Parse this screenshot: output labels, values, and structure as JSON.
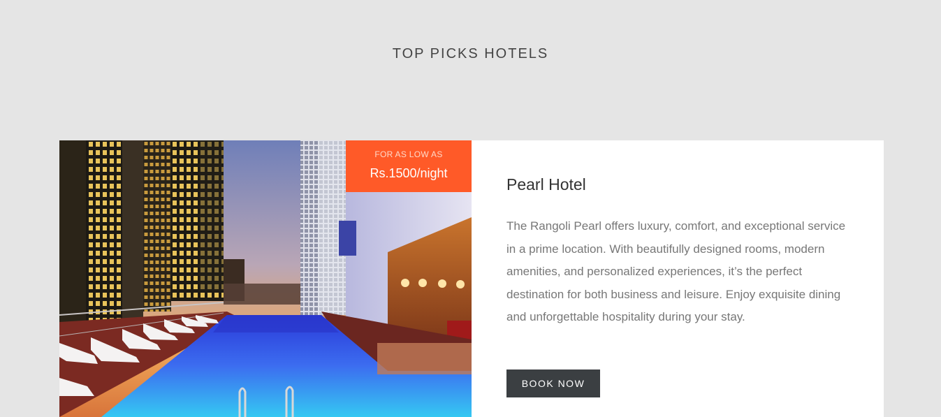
{
  "section": {
    "title": "TOP PICKS HOTELS"
  },
  "hotel": {
    "name": "Pearl Hotel",
    "description": "The Rangoli Pearl offers luxury, comfort, and exceptional service in a prime location. With beautifully designed rooms, modern amenities, and personalized experiences, it’s the perfect destination for both business and leisure. Enjoy exquisite dining and unforgettable hospitality during your stay.",
    "price_caption": "FOR AS LOW AS",
    "price": "Rs.1500/night",
    "book_label": "BOOK NOW",
    "photo_subject": "rooftop-pool-at-dusk"
  },
  "colors": {
    "background": "#e5e5e5",
    "accent": "#ff5a28",
    "button": "#3b3f42"
  }
}
